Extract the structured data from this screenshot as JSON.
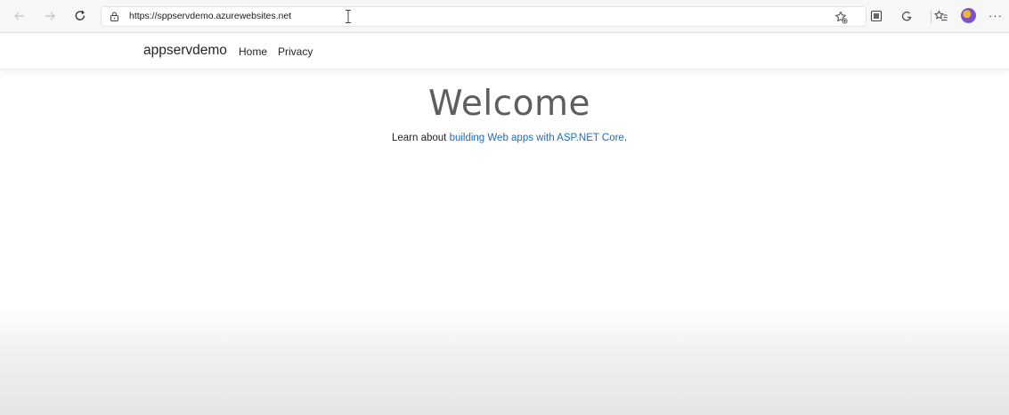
{
  "browser": {
    "url": "https://sppservdemo.azurewebsites.net",
    "more_label": "···"
  },
  "site": {
    "brand": "appservdemo",
    "nav": [
      {
        "label": "Home"
      },
      {
        "label": "Privacy"
      }
    ]
  },
  "main": {
    "heading": "Welcome",
    "intro_prefix": "Learn about ",
    "intro_link": "building Web apps with ASP.NET Core",
    "intro_suffix": "."
  },
  "colors": {
    "link": "#1b6ec2",
    "text": "#212529",
    "chrome_bg": "#f7f7f7"
  }
}
